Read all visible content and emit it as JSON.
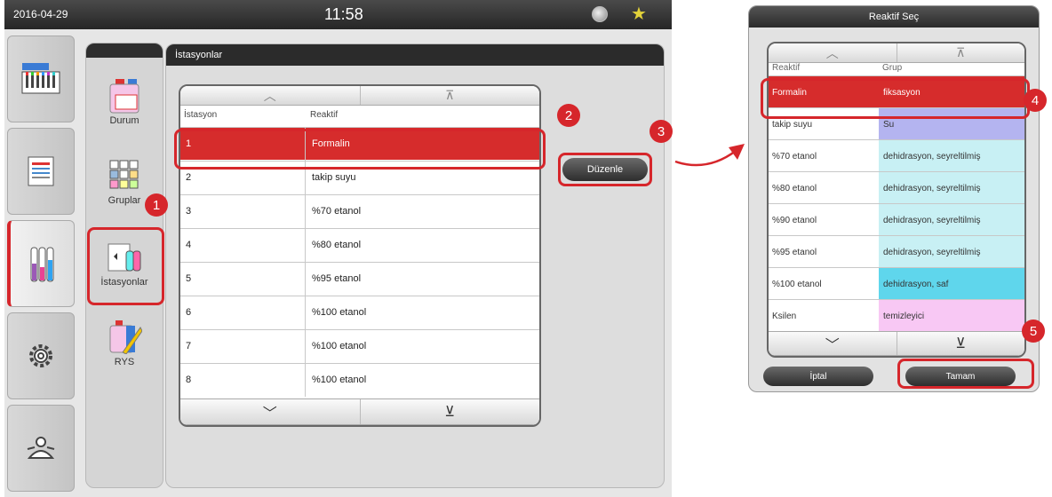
{
  "status_bar": {
    "date": "2016-04-29",
    "time": "11:58"
  },
  "sub_nav": {
    "items": [
      {
        "label": "Durum"
      },
      {
        "label": "Gruplar"
      },
      {
        "label": "İstasyonlar"
      },
      {
        "label": "RYS"
      }
    ]
  },
  "panel": {
    "title": "İstasyonlar"
  },
  "stations": {
    "col_station": "İstasyon",
    "col_reagent": "Reaktif",
    "rows": [
      {
        "station": "1",
        "reagent": "Formalin"
      },
      {
        "station": "2",
        "reagent": "takip suyu"
      },
      {
        "station": "3",
        "reagent": "%70 etanol"
      },
      {
        "station": "4",
        "reagent": "%80 etanol"
      },
      {
        "station": "5",
        "reagent": "%95 etanol"
      },
      {
        "station": "6",
        "reagent": "%100 etanol"
      },
      {
        "station": "7",
        "reagent": "%100 etanol"
      },
      {
        "station": "8",
        "reagent": "%100 etanol"
      }
    ]
  },
  "edit_button": "Düzenle",
  "dialog": {
    "title": "Reaktif Seç",
    "col_reagent": "Reaktif",
    "col_group": "Grup",
    "rows": [
      {
        "reagent": "Formalin",
        "group": "fiksasyon",
        "color": "#d62c2c"
      },
      {
        "reagent": "takip suyu",
        "group": "Su",
        "color": "#b4b4f0"
      },
      {
        "reagent": "%70 etanol",
        "group": "dehidrasyon, seyreltilmiş",
        "color": "#c8f0f4"
      },
      {
        "reagent": "%80 etanol",
        "group": "dehidrasyon, seyreltilmiş",
        "color": "#c8f0f4"
      },
      {
        "reagent": "%90 etanol",
        "group": "dehidrasyon, seyreltilmiş",
        "color": "#c8f0f4"
      },
      {
        "reagent": "%95 etanol",
        "group": "dehidrasyon, seyreltilmiş",
        "color": "#c8f0f4"
      },
      {
        "reagent": "%100 etanol",
        "group": "dehidrasyon, saf",
        "color": "#5fd6ec"
      },
      {
        "reagent": "Ksilen",
        "group": "temizleyici",
        "color": "#f8c8f4"
      }
    ],
    "cancel": "İptal",
    "ok": "Tamam"
  },
  "callouts": [
    "1",
    "2",
    "3",
    "4",
    "5"
  ],
  "colors": {
    "highlight": "#d6262b",
    "selection": "#d62c2c"
  }
}
